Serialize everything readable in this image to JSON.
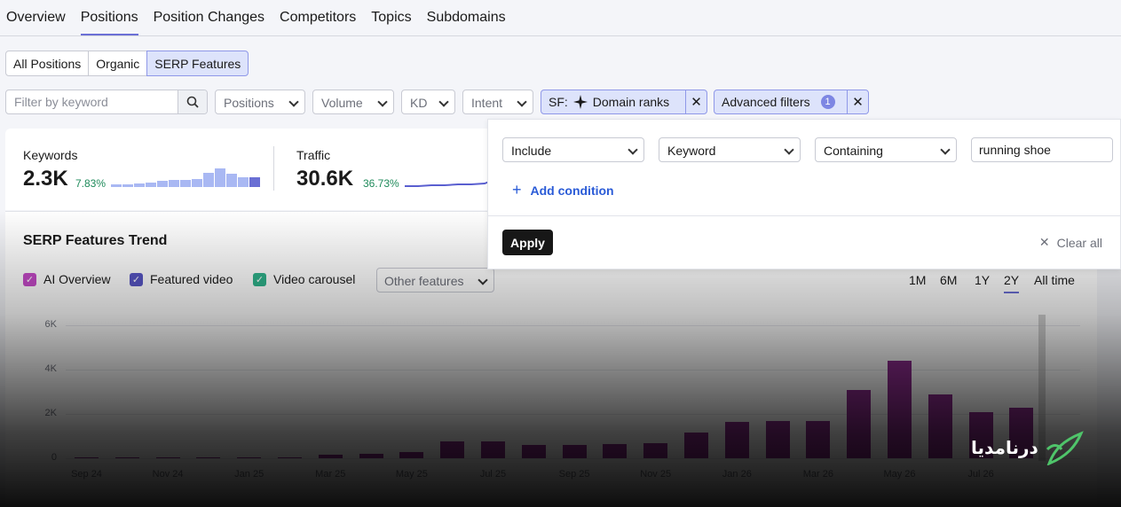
{
  "top_tabs": [
    "Overview",
    "Positions",
    "Position Changes",
    "Competitors",
    "Topics",
    "Subdomains"
  ],
  "sub_tabs": [
    "All Positions",
    "Organic",
    "SERP Features"
  ],
  "filters": {
    "search_placeholder": "Filter by keyword",
    "positions": "Positions",
    "volume": "Volume",
    "kd": "KD",
    "intent": "Intent",
    "sf_prefix": "SF:",
    "sf_value": "Domain ranks",
    "advanced": "Advanced filters",
    "advanced_count": "1"
  },
  "metrics": {
    "keywords_label": "Keywords",
    "keywords_value": "2.3K",
    "keywords_delta": "7.83%",
    "traffic_label": "Traffic",
    "traffic_value": "30.6K",
    "traffic_delta": "36.73%"
  },
  "advanced_panel": {
    "include": "Include",
    "field": "Keyword",
    "operator": "Containing",
    "value": "running shoe",
    "add_condition": "Add condition",
    "apply": "Apply",
    "clear_all": "Clear all"
  },
  "trend": {
    "title": "SERP Features Trend",
    "legend": [
      {
        "label": "AI Overview",
        "color": "#c44ac7"
      },
      {
        "label": "Featured video",
        "color": "#5755c4"
      },
      {
        "label": "Video carousel",
        "color": "#2fb38b"
      }
    ],
    "other_features": "Other features",
    "ranges": [
      "1M",
      "6M",
      "1Y",
      "2Y",
      "All time"
    ],
    "active_range": "2Y"
  },
  "chart_data": {
    "type": "bar",
    "y_ticks": [
      "6K",
      "4K",
      "2K",
      "0"
    ],
    "x_ticks": [
      "Sep 24",
      "Nov 24",
      "Jan 25",
      "Mar 25",
      "May 25",
      "Jul 25",
      "Sep 25",
      "Nov 25",
      "Jan 26",
      "Mar 26",
      "May 26",
      "Jul 26"
    ],
    "ylim": [
      0,
      6000
    ],
    "values": [
      0,
      0,
      30,
      40,
      50,
      40,
      150,
      200,
      300,
      750,
      750,
      600,
      600,
      650,
      700,
      1150,
      1650,
      1700,
      1700,
      3100,
      4400,
      2900,
      2100,
      2300
    ]
  },
  "watermark": "درنامدیا"
}
